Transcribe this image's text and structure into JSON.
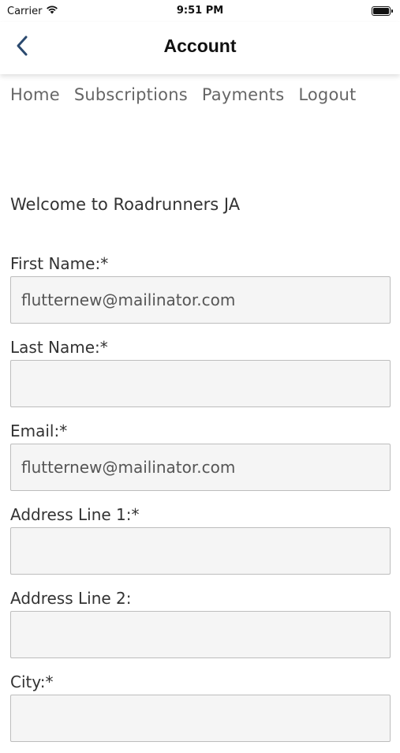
{
  "status_bar": {
    "carrier": "Carrier",
    "time": "9:51 PM"
  },
  "header": {
    "title": "Account",
    "back_icon": "chevron-left-icon"
  },
  "menu": {
    "items": [
      {
        "label": "Home"
      },
      {
        "label": "Subscriptions"
      },
      {
        "label": "Payments"
      },
      {
        "label": "Logout"
      }
    ]
  },
  "welcome_text": "Welcome to Roadrunners JA",
  "form": {
    "fields": [
      {
        "label": "First Name:*",
        "value": "flutternew@mailinator.com"
      },
      {
        "label": "Last Name:*",
        "value": ""
      },
      {
        "label": "Email:*",
        "value": "flutternew@mailinator.com"
      },
      {
        "label": "Address Line 1:*",
        "value": ""
      },
      {
        "label": "Address Line 2:",
        "value": ""
      },
      {
        "label": "City:*",
        "value": ""
      }
    ]
  },
  "colors": {
    "accent": "#2b4a6f",
    "menu_text": "#666666",
    "input_bg": "#f5f5f5",
    "input_border": "#bdbdbd"
  }
}
